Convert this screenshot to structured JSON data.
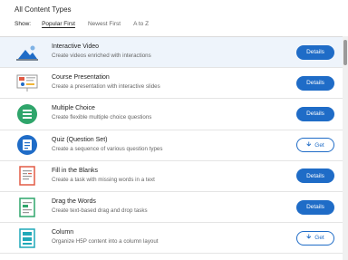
{
  "header": {
    "title": "All Content Types",
    "show_label": "Show:",
    "sort_options": [
      "Popular First",
      "Newest First",
      "A to Z"
    ]
  },
  "colors": {
    "accent": "#1f6cc7",
    "highlight_row": "#eef4fb"
  },
  "items": [
    {
      "name": "Interactive Video",
      "desc": "Create videos enriched with interactions",
      "button": "Details",
      "icon": "interactive-video-icon"
    },
    {
      "name": "Course Presentation",
      "desc": "Create a presentation with interactive slides",
      "button": "Details",
      "icon": "course-presentation-icon"
    },
    {
      "name": "Multiple Choice",
      "desc": "Create flexible multiple choice questions",
      "button": "Details",
      "icon": "multiple-choice-icon"
    },
    {
      "name": "Quiz (Question Set)",
      "desc": "Create a sequence of various question types",
      "button": "Get",
      "icon": "quiz-icon"
    },
    {
      "name": "Fill in the Blanks",
      "desc": "Create a task with missing words in a text",
      "button": "Details",
      "icon": "fill-in-the-blanks-icon"
    },
    {
      "name": "Drag the Words",
      "desc": "Create text-based drag and drop tasks",
      "button": "Details",
      "icon": "drag-the-words-icon"
    },
    {
      "name": "Column",
      "desc": "Organize H5P content into a column layout",
      "button": "Get",
      "icon": "column-icon"
    }
  ]
}
